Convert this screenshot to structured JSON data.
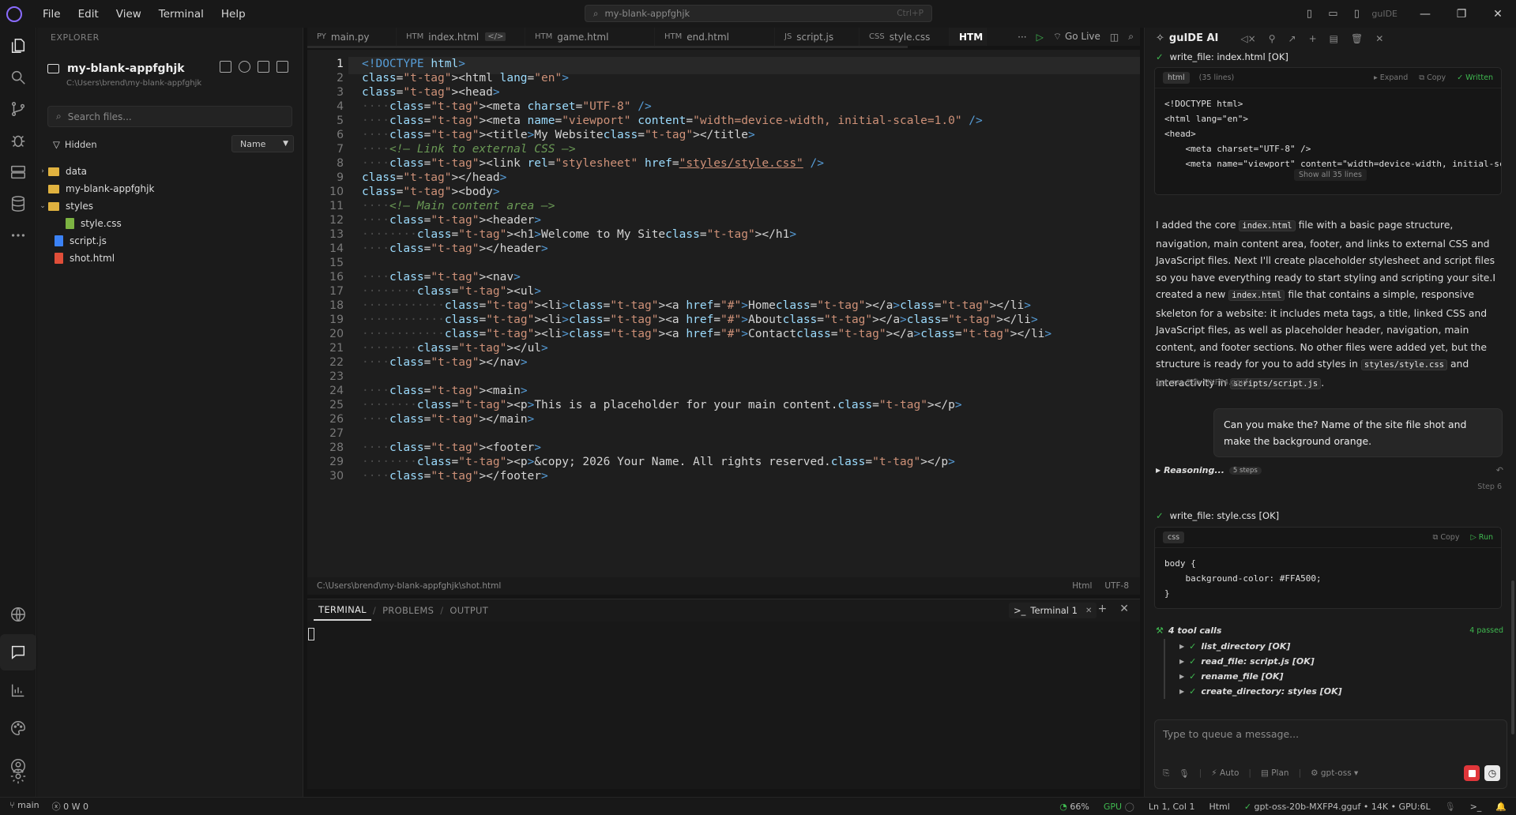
{
  "titlebar": {
    "menus": [
      "File",
      "Edit",
      "View",
      "Terminal",
      "Help"
    ],
    "search_text": "my-blank-appfghjk",
    "search_shortcut": "Ctrl+P",
    "brand": "guIDE"
  },
  "explorer": {
    "title": "EXPLORER",
    "project_name": "my-blank-appfghjk",
    "project_path": "C:\\Users\\brend\\my-blank-appfghjk",
    "search_placeholder": "Search files...",
    "hidden_label": "Hidden",
    "sort_value": "Name",
    "tree": [
      {
        "name": "data",
        "type": "folder",
        "expanded": false
      },
      {
        "name": "my-blank-appfghjk",
        "type": "folder",
        "expanded": false
      },
      {
        "name": "styles",
        "type": "folder",
        "expanded": true
      },
      {
        "name": "style.css",
        "type": "css"
      },
      {
        "name": "script.js",
        "type": "js"
      },
      {
        "name": "shot.html",
        "type": "html"
      }
    ]
  },
  "tabs": [
    {
      "type": "PY",
      "name": "main.py"
    },
    {
      "type": "HTM",
      "name": "index.html"
    },
    {
      "type": "HTM",
      "name": "game.html"
    },
    {
      "type": "HTM",
      "name": "end.html"
    },
    {
      "type": "JS",
      "name": "script.js"
    },
    {
      "type": "CSS",
      "name": "style.css"
    },
    {
      "type": "",
      "name": "HTM",
      "active": true
    }
  ],
  "tab_tools": {
    "go_live": "Go Live"
  },
  "code": {
    "current_line": 1,
    "lines": [
      "<!DOCTYPE html>",
      "<html lang=\"en\">",
      "<head>",
      "    <meta charset=\"UTF-8\" />",
      "    <meta name=\"viewport\" content=\"width=device-width, initial-scale=1.0\" />",
      "    <title>My Website</title>",
      "    <!-- Link to external CSS -->",
      "    <link rel=\"stylesheet\" href=\"styles/style.css\" />",
      "</head>",
      "<body>",
      "    <!-- Main content area -->",
      "    <header>",
      "        <h1>Welcome to My Site</h1>",
      "    </header>",
      "",
      "    <nav>",
      "        <ul>",
      "            <li><a href=\"#\">Home</a></li>",
      "            <li><a href=\"#\">About</a></li>",
      "            <li><a href=\"#\">Contact</a></li>",
      "        </ul>",
      "    </nav>",
      "",
      "    <main>",
      "        <p>This is a placeholder for your main content.</p>",
      "    </main>",
      "",
      "    <footer>",
      "        <p>&copy; 2026 Your Name. All rights reserved.</p>",
      "    </footer>"
    ]
  },
  "editor_status": {
    "path": "C:\\Users\\brend\\my-blank-appfghjk\\shot.html",
    "language": "Html",
    "encoding": "UTF-8"
  },
  "panel": {
    "tabs": [
      "TERMINAL",
      "PROBLEMS",
      "OUTPUT"
    ],
    "terminal_tab": "Terminal 1"
  },
  "ai": {
    "title": "guIDE AI",
    "write_index": "write_file: index.html [OK]",
    "card1": {
      "lang": "html",
      "lines_count": "(35 lines)",
      "expand": "Expand",
      "copy": "Copy",
      "written": "Written",
      "code": "<!DOCTYPE html>\n<html lang=\"en\">\n<head>\n    <meta charset=\"UTF-8\" />\n    <meta name=\"viewport\" content=\"width=device-width, initial-sc",
      "show_all": "Show all 35 lines"
    },
    "para": {
      "p1": "I added the core ",
      "c1": "index.html",
      "p2": " file with a basic page structure, navigation, main content area, footer, and links to external CSS and JavaScript files. Next I'll create placeholder stylesheet and script files so you have everything ready to start styling and scripting your site.I created a new ",
      "c2": "index.html",
      "p3": " file that contains a simple, responsive skeleton for a website: it includes meta tags, a title, linked CSS and JavaScript files, as well as placeholder header, navigation, main content, and footer sections. No other files were added yet, but the structure is ready for you to add styles in ",
      "c3": "styles/style.css",
      "p4": " and interactivity in ",
      "c4": "scripts/script.js",
      "p5": "."
    },
    "model_label": "gpt-oss-20b-MXFP4.gguf",
    "user_message": "Can you make the? Name of the site file shot and make the background orange.",
    "reasoning": {
      "label": "Reasoning...",
      "badge": "5 steps",
      "step": "Step 6"
    },
    "write_style": "write_file: style.css [OK]",
    "card2": {
      "lang": "css",
      "copy": "Copy",
      "run": "Run",
      "code": "body {\n    background-color: #FFA500;\n}"
    },
    "tool_calls": {
      "head": "4 tool calls",
      "passed": "4 passed",
      "items": [
        "list_directory [OK]",
        "read_file: script.js [OK]",
        "rename_file [OK]",
        "create_directory: styles [OK]"
      ]
    },
    "composer": {
      "placeholder": "Type to queue a message...",
      "auto": "Auto",
      "plan": "Plan",
      "model": "gpt-oss"
    }
  },
  "statusbar": {
    "branch": "main",
    "problems": "0",
    "warnings": "W 0",
    "cpu": "66%",
    "gpu": "GPU",
    "position": "Ln 1, Col 1",
    "language": "Html",
    "model_info": "gpt-oss-20b-MXFP4.gguf • 14K • GPU:6L"
  },
  "colors": {
    "accent": "#3fb950",
    "stop": "#e0363a",
    "tag": "#569cd6",
    "attr": "#9cdcfe",
    "string": "#ce9178",
    "comment": "#6a9955"
  }
}
